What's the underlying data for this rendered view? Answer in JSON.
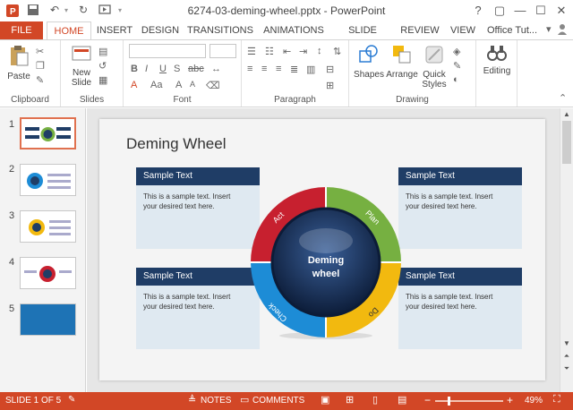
{
  "window": {
    "title": "6274-03-deming-wheel.pptx - PowerPoint",
    "buttons": {
      "help": "?",
      "restore": "▢",
      "minimize": "—",
      "maximize": "☐",
      "close": "✕"
    }
  },
  "tabs": {
    "file": "FILE",
    "items": [
      "HOME",
      "INSERT",
      "DESIGN",
      "TRANSITIONS",
      "ANIMATIONS",
      "SLIDE SHOW",
      "REVIEW",
      "VIEW"
    ],
    "active": "HOME",
    "account": "Office Tut..."
  },
  "ribbon": {
    "clipboard": {
      "label": "Clipboard",
      "paste": "Paste"
    },
    "slides": {
      "label": "Slides",
      "new_slide": "New",
      "new_slide2": "Slide"
    },
    "font": {
      "label": "Font"
    },
    "paragraph": {
      "label": "Paragraph"
    },
    "drawing": {
      "label": "Drawing",
      "shapes": "Shapes",
      "arrange": "Arrange",
      "quick": "Quick",
      "styles": "Styles"
    },
    "editing": {
      "label": "Editing"
    }
  },
  "thumbnails": [
    "1",
    "2",
    "3",
    "4",
    "5"
  ],
  "slide": {
    "title": "Deming Wheel",
    "center_line1": "Deming",
    "center_line2": "wheel",
    "segments": [
      "Act",
      "Plan",
      "Do",
      "Check"
    ],
    "boxes": [
      {
        "header": "Sample Text",
        "line1": "This is a sample text. Insert",
        "line2": "your desired text here."
      },
      {
        "header": "Sample Text",
        "line1": "This is a sample text. Insert",
        "line2": "your desired text here."
      },
      {
        "header": "Sample Text",
        "line1": "This is a sample text. Insert",
        "line2": "your desired text here."
      },
      {
        "header": "Sample Text",
        "line1": "This is a sample text. Insert",
        "line2": "your desired text here."
      }
    ]
  },
  "status": {
    "slide_count": "SLIDE 1 OF 5",
    "notes": "NOTES",
    "comments": "COMMENTS",
    "zoom": "49%",
    "zoom_minus": "−",
    "zoom_plus": "+"
  },
  "colors": {
    "accent": "#d24726",
    "act": "#c7202f",
    "plan": "#76b041",
    "do": "#f2b90f",
    "check": "#1d8cd6",
    "box_header": "#1f3d66"
  }
}
